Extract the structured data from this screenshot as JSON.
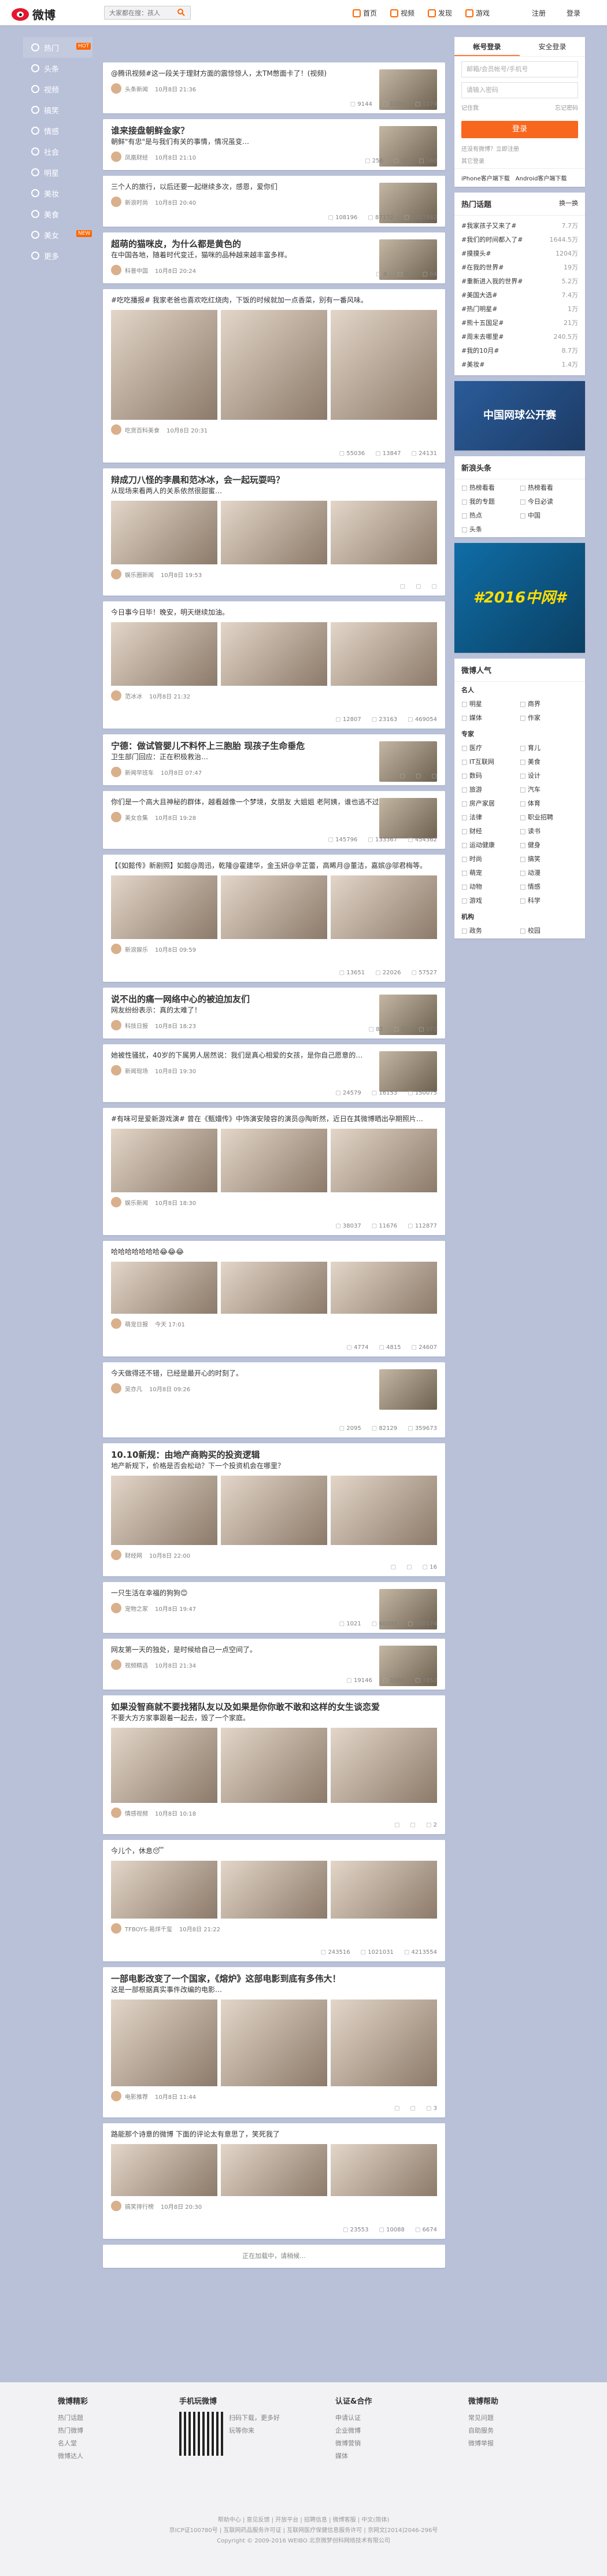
{
  "topbar": {
    "logo_text": "微博",
    "search_placeholder": "大家都在搜：孩人",
    "nav": [
      "首页",
      "视频",
      "发现",
      "游戏",
      "注册",
      "登录"
    ]
  },
  "sidebar": {
    "items": [
      {
        "label": "热门",
        "badge": "HOT",
        "active": true
      },
      {
        "label": "头条",
        "badge": ""
      },
      {
        "label": "视频",
        "badge": ""
      },
      {
        "label": "搞笑",
        "badge": ""
      },
      {
        "label": "情感",
        "badge": ""
      },
      {
        "label": "社会",
        "badge": ""
      },
      {
        "label": "明星",
        "badge": ""
      },
      {
        "label": "美妆",
        "badge": ""
      },
      {
        "label": "美食",
        "badge": ""
      },
      {
        "label": "美女",
        "badge": "NEW"
      },
      {
        "label": "更多",
        "badge": ""
      }
    ]
  },
  "feed": {
    "cards": [
      {
        "title": "",
        "text": "@腾讯视频#这一段关于理财方面的震惊惊人，太TM憋面卡了！(视频)",
        "author": "头条新闻",
        "time": "10月8日 21:36",
        "stats": [
          "9144",
          "1200",
          "1274"
        ]
      },
      {
        "title": "谁来接盘朝鲜金家？",
        "text": "朝鲜\"有忠\"是与我们有关的事情，情况虽变…",
        "author": "凤凰财经",
        "time": "10月8日 21:10",
        "stats": [
          "256",
          "60",
          "160"
        ]
      },
      {
        "title": "",
        "text": "三个人的旅行，以后还要一起继续多次，感恩，爱你们",
        "author": "新浪时尚",
        "time": "10月8日 20:40",
        "stats": [
          "108196",
          "87172",
          "1157562"
        ]
      },
      {
        "title": "超萌的猫咪皮，为什么都是黄色的",
        "text": "在中国各地，随着时代变迁，猫咪的品种越来越丰富多样。",
        "author": "科普中国",
        "time": "10月8日 20:24",
        "stats": [
          "4",
          "23",
          "64"
        ]
      },
      {
        "title": "",
        "text": "#吃吃播报# 我家老爸也喜欢吃红烧肉，下饭的时候就加一点香菜，别有一番风味。",
        "author": "吃货百科美食",
        "time": "10月8日 20:31",
        "stats": [
          "55036",
          "13847",
          "24131"
        ]
      },
      {
        "title": "辩成刀八怪的李晨和范冰冰，会一起玩耍吗？",
        "text": "从现场来看两人的关系依然很甜蜜…",
        "author": "娱乐圈新闻",
        "time": "10月8日 19:53",
        "stats": [
          "",
          "",
          ""
        ]
      },
      {
        "title": "",
        "text": "今日事今日毕！晚安，明天继续加油。",
        "author": "范冰冰",
        "time": "10月8日 21:32",
        "stats": [
          "12807",
          "23163",
          "469054"
        ]
      },
      {
        "title": "宁德：做试管婴儿不料怀上三胞胎 现孩子生命垂危",
        "text": "卫生部门回应：正在积极救治…",
        "author": "新闻早班车",
        "time": "10月8日 07:47",
        "stats": [
          "",
          "",
          ""
        ]
      },
      {
        "title": "",
        "text": "你们是一个高大且神秘的群体，越看越像一个梦境，女朋友 大姐姐 老阿姨，谁也逃不过你。",
        "author": "美女合集",
        "time": "10月8日 19:28",
        "stats": [
          "145796",
          "133367",
          "454362"
        ]
      },
      {
        "title": "",
        "text": "【《如懿传》新剧照】如懿@周迅，乾隆@霍建华，金玉妍@辛芷蕾，高晞月@董洁，嘉嫔@邬君梅等。",
        "author": "新浪娱乐",
        "time": "10月8日 09:59",
        "stats": [
          "13651",
          "22026",
          "57527"
        ]
      },
      {
        "title": "说不出的痛一网络中心的被迫加友们",
        "text": "网友纷纷表示：真的太难了！",
        "author": "科技日报",
        "time": "10月8日 18:23",
        "stats": [
          "82",
          "52",
          "371"
        ]
      },
      {
        "title": "",
        "text": "她被性骚扰，40岁的下属男人居然说：我们是真心相爱的女孩，是你自己愿意的…",
        "author": "新闻现场",
        "time": "10月8日 19:30",
        "stats": [
          "24579",
          "16153",
          "150075"
        ]
      },
      {
        "title": "",
        "text": "#有味可是爱新游戏演# 曾在《甄嬛传》中饰演安陵容的演员@陶昕然，近日在其微博晒出孕期照片…",
        "author": "娱乐新闻",
        "time": "10月8日 18:30",
        "stats": [
          "38037",
          "11676",
          "112877"
        ]
      },
      {
        "title": "",
        "text": "哈哈哈哈哈哈哈😂😂😂",
        "author": "萌宠日报",
        "time": "今天 17:01",
        "stats": [
          "4774",
          "4815",
          "24607"
        ]
      },
      {
        "title": "",
        "text": "今天做得还不错，已经是最开心的时刻了。",
        "author": "吴亦凡",
        "time": "10月8日 09:26",
        "stats": [
          "2095",
          "82129",
          "359673"
        ]
      },
      {
        "title": "10.10新规：由地产商购买的投资逻辑",
        "text": "地产新规下，价格是否会松动？下一个投资机会在哪里？",
        "author": "财经网",
        "time": "10月8日 22:00",
        "stats": [
          "",
          "",
          "16"
        ]
      },
      {
        "title": "",
        "text": "一只生活在幸福的狗狗😊",
        "author": "宠物之家",
        "time": "10月8日 19:47",
        "stats": [
          "1021",
          "60393",
          "200174"
        ]
      },
      {
        "title": "",
        "text": "网友第一天的独处，是时候给自己一点空间了。",
        "author": "视频精选",
        "time": "10月8日 21:34",
        "stats": [
          "19146",
          "1096",
          "7852"
        ]
      },
      {
        "title": "如果没智商就不要找猪队友以及如果是你你敢不敢和这样的女生谈恋爱",
        "text": "不要大方方家事跟着一起去，毁了一个家庭。",
        "author": "情感视频",
        "time": "10月8日 10:18",
        "stats": [
          "",
          "",
          "2"
        ]
      },
      {
        "title": "",
        "text": "今儿个，休息😴",
        "author": "TFBOYS-易烊千玺",
        "time": "10月8日 21:22",
        "stats": [
          "243516",
          "1021031",
          "4213554"
        ]
      },
      {
        "title": "一部电影改变了一个国家，《熔炉》这部电影到底有多伟大！",
        "text": "这是一部根据真实事件改编的电影…",
        "author": "电影推荐",
        "time": "10月8日 11:44",
        "stats": [
          "",
          "",
          "3"
        ]
      },
      {
        "title": "",
        "text": "路能那个诗意的微博 下面的评论太有意思了，笑死我了",
        "author": "搞笑排行榜",
        "time": "10月8日 20:30",
        "stats": [
          "23553",
          "10088",
          "6674"
        ]
      }
    ],
    "loading_text": "正在加载中，请稍候..."
  },
  "right": {
    "tabs": [
      "帐号登录",
      "安全登录"
    ],
    "username_placeholder": "邮箱/会员帐号/手机号",
    "password_placeholder": "请输入密码",
    "remember_label": "记住我",
    "forgot_label": "忘记密码",
    "login_label": "登录",
    "register_text": "还没有微博？立即注册",
    "other_login": "其它登录",
    "apps": [
      "iPhone客户端下载",
      "Android客户端下载"
    ],
    "hot_title": "热门话题",
    "hot_change": "换一换",
    "hot_topics": [
      {
        "name": "#我家孩子又来了#",
        "v": "7.7万"
      },
      {
        "name": "#我们的时间都入了#",
        "v": "1644.5万"
      },
      {
        "name": "#摸摸头#",
        "v": "1204万"
      },
      {
        "name": "#在我的世界#",
        "v": "19万"
      },
      {
        "name": "#重新进入我的世界#",
        "v": "5.2万"
      },
      {
        "name": "#美国大选#",
        "v": "7.4万"
      },
      {
        "name": "#热门明星#",
        "v": "1万"
      },
      {
        "name": "#熊十五国足#",
        "v": "21万"
      },
      {
        "name": "#周末去哪里#",
        "v": "240.5万"
      },
      {
        "name": "#我的10月#",
        "v": "8.7万"
      },
      {
        "name": "#美妆#",
        "v": "1.4万"
      }
    ],
    "banner1_text": "中国网球公开赛",
    "news_title": "新浪头条",
    "news_tags": [
      "热榜看看",
      "热榜看看",
      "我的专题",
      "今日必读",
      "热点",
      "中国",
      "头条"
    ],
    "banner2_text": "#2016中网#",
    "cat_title": "微博人气",
    "cat_groups": [
      {
        "label": "名人",
        "items": [
          "明星",
          "商界",
          "媒体",
          "作家"
        ]
      },
      {
        "label": "专家",
        "items": [
          "医疗",
          "育儿",
          "IT互联网",
          "美食",
          "数码",
          "设计",
          "旅游",
          "汽车",
          "房产家居",
          "体育",
          "法律",
          "职业招聘",
          "财经",
          "读书",
          "运动健康",
          "健身",
          "时尚",
          "搞笑",
          "萌宠",
          "动漫",
          "动物",
          "情感",
          "游戏",
          "科学"
        ]
      },
      {
        "label": "机构",
        "items": [
          "政务",
          "校园"
        ]
      }
    ]
  },
  "footer": {
    "cols": [
      {
        "title": "微博精彩",
        "items": [
          "热门话题",
          "热门微博",
          "名人堂",
          "微博达人"
        ]
      },
      {
        "title": "手机玩微博",
        "items": [
          "扫码下载，更多好玩等你来"
        ]
      },
      {
        "title": "认证&合作",
        "items": [
          "申请认证",
          "企业微博",
          "微博营销",
          "媒体"
        ]
      },
      {
        "title": "微博帮助",
        "items": [
          "常见问题",
          "自助服务",
          "微博举报"
        ]
      }
    ],
    "bottom_lines": [
      "帮助中心 | 意见反馈 | 开放平台 | 招聘信息 | 微博客服 | 中文(简体)",
      "京ICP证100780号 | 互联网药品服务许可证 | 互联网医疗保健信息服务许可 | 京网文[2014]2046-296号",
      "Copyright © 2009-2016 WEIBO 北京微梦创科网络技术有限公司"
    ]
  }
}
